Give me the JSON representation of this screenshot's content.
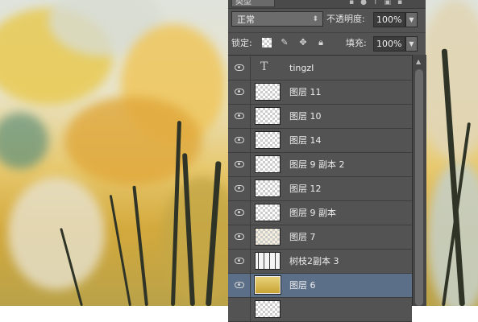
{
  "panel": {
    "kind_label": "类型",
    "blend_mode": "正常",
    "opacity_label": "不透明度:",
    "opacity_value": "100%",
    "lock_label": "锁定:",
    "fill_label": "填充:",
    "fill_value": "100%"
  },
  "layers": [
    {
      "name": "tingzI",
      "type": "text",
      "visible": true,
      "selected": false
    },
    {
      "name": "图层 11",
      "type": "pixel",
      "visible": true,
      "selected": false
    },
    {
      "name": "图层 10",
      "type": "pixel",
      "visible": true,
      "selected": false
    },
    {
      "name": "图层 14",
      "type": "pixel",
      "visible": true,
      "selected": false
    },
    {
      "name": "图层 9 副本 2",
      "type": "pixel",
      "visible": true,
      "selected": false
    },
    {
      "name": "图层 12",
      "type": "pixel",
      "visible": true,
      "selected": false
    },
    {
      "name": "图层 9 副本",
      "type": "pixel",
      "visible": true,
      "selected": false
    },
    {
      "name": "图层 7",
      "type": "pixel",
      "visible": true,
      "selected": false
    },
    {
      "name": "树枝2副本 3",
      "type": "pixel",
      "visible": true,
      "selected": false
    },
    {
      "name": "图层 6",
      "type": "pixel",
      "visible": true,
      "selected": true
    }
  ],
  "icons": {
    "text_layer": "T-glyph",
    "visibility": "eye-icon",
    "lock_transparent": "checker-icon",
    "lock_image": "brush-icon",
    "lock_position": "move-icon",
    "lock_all": "lock-icon"
  },
  "colors": {
    "panel_bg": "#535353",
    "selected_row": "#5b6f88"
  }
}
